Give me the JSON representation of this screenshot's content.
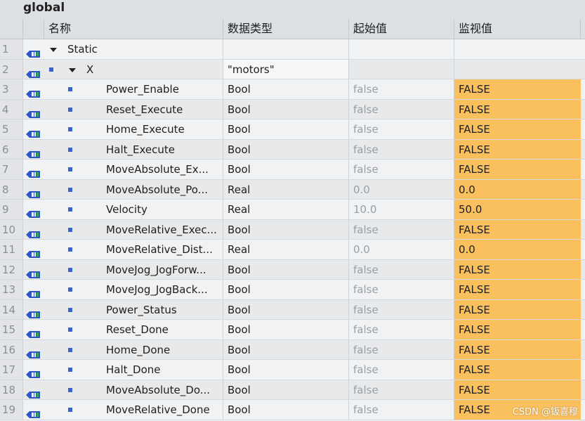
{
  "window": {
    "title": "global"
  },
  "columns": {
    "name": "名称",
    "data_type": "数据类型",
    "start_value": "起始值",
    "monitor_value": "监视值"
  },
  "rows": [
    {
      "num": "1",
      "name": "Static",
      "type": "",
      "start": "",
      "monitor": "",
      "level": 0,
      "expand": true,
      "bullet": false,
      "highlight": false
    },
    {
      "num": "2",
      "name": "X",
      "type": "\"motors\"",
      "start": "",
      "monitor": "",
      "level": 1,
      "expand": true,
      "bullet": true,
      "highlight": false
    },
    {
      "num": "3",
      "name": "Power_Enable",
      "type": "Bool",
      "start": "false",
      "monitor": "FALSE",
      "level": 2,
      "expand": false,
      "bullet": true,
      "highlight": true
    },
    {
      "num": "4",
      "name": "Reset_Execute",
      "type": "Bool",
      "start": "false",
      "monitor": "FALSE",
      "level": 2,
      "expand": false,
      "bullet": true,
      "highlight": true
    },
    {
      "num": "5",
      "name": "Home_Execute",
      "type": "Bool",
      "start": "false",
      "monitor": "FALSE",
      "level": 2,
      "expand": false,
      "bullet": true,
      "highlight": true
    },
    {
      "num": "6",
      "name": "Halt_Execute",
      "type": "Bool",
      "start": "false",
      "monitor": "FALSE",
      "level": 2,
      "expand": false,
      "bullet": true,
      "highlight": true
    },
    {
      "num": "7",
      "name": "MoveAbsolute_Ex...",
      "type": "Bool",
      "start": "false",
      "monitor": "FALSE",
      "level": 2,
      "expand": false,
      "bullet": true,
      "highlight": true
    },
    {
      "num": "8",
      "name": "MoveAbsolute_Po...",
      "type": "Real",
      "start": "0.0",
      "monitor": "0.0",
      "level": 2,
      "expand": false,
      "bullet": true,
      "highlight": true
    },
    {
      "num": "9",
      "name": "Velocity",
      "type": "Real",
      "start": "10.0",
      "monitor": "50.0",
      "level": 2,
      "expand": false,
      "bullet": true,
      "highlight": true
    },
    {
      "num": "10",
      "name": "MoveRelative_Exec...",
      "type": "Bool",
      "start": "false",
      "monitor": "FALSE",
      "level": 2,
      "expand": false,
      "bullet": true,
      "highlight": true
    },
    {
      "num": "11",
      "name": "MoveRelative_Dist...",
      "type": "Real",
      "start": "0.0",
      "monitor": "0.0",
      "level": 2,
      "expand": false,
      "bullet": true,
      "highlight": true
    },
    {
      "num": "12",
      "name": "MoveJog_JogForw...",
      "type": "Bool",
      "start": "false",
      "monitor": "FALSE",
      "level": 2,
      "expand": false,
      "bullet": true,
      "highlight": true
    },
    {
      "num": "13",
      "name": "MoveJog_JogBack...",
      "type": "Bool",
      "start": "false",
      "monitor": "FALSE",
      "level": 2,
      "expand": false,
      "bullet": true,
      "highlight": true
    },
    {
      "num": "14",
      "name": "Power_Status",
      "type": "Bool",
      "start": "false",
      "monitor": "FALSE",
      "level": 2,
      "expand": false,
      "bullet": true,
      "highlight": true
    },
    {
      "num": "15",
      "name": "Reset_Done",
      "type": "Bool",
      "start": "false",
      "monitor": "FALSE",
      "level": 2,
      "expand": false,
      "bullet": true,
      "highlight": true
    },
    {
      "num": "16",
      "name": "Home_Done",
      "type": "Bool",
      "start": "false",
      "monitor": "FALSE",
      "level": 2,
      "expand": false,
      "bullet": true,
      "highlight": true
    },
    {
      "num": "17",
      "name": "Halt_Done",
      "type": "Bool",
      "start": "false",
      "monitor": "FALSE",
      "level": 2,
      "expand": false,
      "bullet": true,
      "highlight": true
    },
    {
      "num": "18",
      "name": "MoveAbsolute_Do...",
      "type": "Bool",
      "start": "false",
      "monitor": "FALSE",
      "level": 2,
      "expand": false,
      "bullet": true,
      "highlight": true
    },
    {
      "num": "19",
      "name": "MoveRelative_Done",
      "type": "Bool",
      "start": "false",
      "monitor": "FALSE",
      "level": 2,
      "expand": false,
      "bullet": true,
      "highlight": true
    }
  ],
  "icons": {
    "row_icon": "interface-tag-icon",
    "expand_icon": "triangle-down-icon",
    "bullet_icon": "member-square-icon"
  },
  "colors": {
    "highlight": "#fbc05e",
    "icon_blue": "#2e57c4",
    "icon_green": "#2fa84f"
  },
  "watermark": "CSDN @钣喜穆"
}
